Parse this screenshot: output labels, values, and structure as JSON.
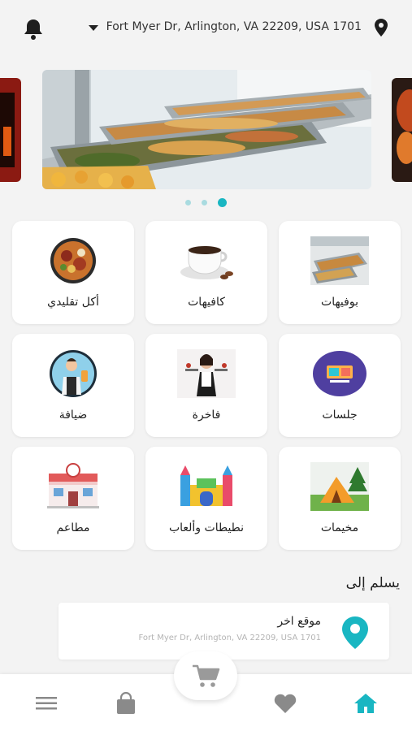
{
  "header": {
    "address": "Fort Myer Dr, Arlington, VA 22209, USA 1701",
    "notifications_icon": "bell-icon",
    "location_icon": "map-pin-icon"
  },
  "carousel": {
    "slide_count": 3,
    "active_index": 2
  },
  "categories": [
    {
      "label": "بوفيهات",
      "icon": "buffet-image"
    },
    {
      "label": "كافيهات",
      "icon": "coffee-cup-image"
    },
    {
      "label": "أكل تقليدي",
      "icon": "traditional-food-image"
    },
    {
      "label": "جلسات",
      "icon": "sessions-image"
    },
    {
      "label": "فاخرة",
      "icon": "luxury-waitress-image"
    },
    {
      "label": "ضيافة",
      "icon": "hospitality-waiter-image"
    },
    {
      "label": "مخيمات",
      "icon": "camping-tent-image"
    },
    {
      "label": "نطيطات وألعاب",
      "icon": "bouncy-castle-image"
    },
    {
      "label": "مطاعم",
      "icon": "restaurant-building-image"
    }
  ],
  "delivery": {
    "title": "يسلم إلى",
    "location_name": "موقع اخر",
    "location_address": "Fort Myer Dr, Arlington, VA 22209, USA 1701"
  },
  "bottom_nav": {
    "items": [
      "home-icon",
      "heart-icon",
      "cart-icon",
      "bag-icon",
      "menu-icon"
    ],
    "active": "home-icon"
  },
  "colors": {
    "accent": "#19b6c2",
    "nav_inactive": "#8a8a8a",
    "background": "#f3f3f3"
  }
}
